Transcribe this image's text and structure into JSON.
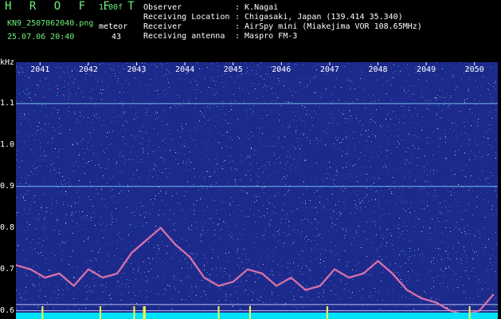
{
  "header": {
    "app_title": "H R O F F T",
    "version": "1.00f",
    "file_name": "KN9_2507062040.png",
    "timestamp": "25.07.06 20:40",
    "meteor_label": "meteor",
    "meteor_count": "43"
  },
  "station": {
    "observer_key": "Observer",
    "observer_val": ": K.Nagai",
    "location_key": "Receiving Location",
    "location_val": ": Chigasaki, Japan (139.414 35.340)",
    "receiver_key": "Receiver",
    "receiver_val": ": AirSpy mini (Miakejima VOR 108.65MHz)",
    "antenna_key": "Receiving antenna",
    "antenna_val": ": Maspro FM-3"
  },
  "axis": {
    "unit": "kHz",
    "ytick_labels": [
      "1.1",
      "1.0",
      "0.9",
      "0.8",
      "0.7",
      "0.6"
    ],
    "xtick_labels": [
      "2041",
      "2042",
      "2043",
      "2044",
      "2045",
      "2046",
      "2047",
      "2048",
      "2049",
      "2050"
    ]
  },
  "colors": {
    "background": "#000000",
    "spectrum_bg": "#1c2a8c",
    "header_green": "#6ff07a",
    "header_white": "#ffffff",
    "trace": "#e06aa0",
    "grid_line": "#7fd8ff",
    "bottom_band": "#00e0ff",
    "meteor_tick": "#ffff40"
  },
  "chart_data": {
    "type": "heatmap",
    "x_unit": "time (HHMM)",
    "y_unit": "kHz",
    "xlim": [
      "2040.5",
      "2050.5"
    ],
    "ylim": [
      0.58,
      1.2
    ],
    "ticks_x": [
      "2041",
      "2042",
      "2043",
      "2044",
      "2045",
      "2046",
      "2047",
      "2048",
      "2049",
      "2050"
    ],
    "ticks_y": [
      1.1,
      1.0,
      0.9,
      0.8,
      0.7,
      0.6
    ],
    "reference_lines_y": [
      1.1,
      0.9,
      0.615,
      0.6
    ],
    "trace": {
      "x": [
        2040.5,
        2040.8,
        2041.1,
        2041.4,
        2041.7,
        2042.0,
        2042.3,
        2042.6,
        2042.9,
        2043.2,
        2043.5,
        2043.8,
        2044.1,
        2044.4,
        2044.7,
        2045.0,
        2045.3,
        2045.6,
        2045.9,
        2046.2,
        2046.5,
        2046.8,
        2047.1,
        2047.4,
        2047.7,
        2048.0,
        2048.3,
        2048.6,
        2048.9,
        2049.2,
        2049.5,
        2049.8,
        2050.1,
        2050.4
      ],
      "y": [
        0.71,
        0.7,
        0.68,
        0.69,
        0.66,
        0.7,
        0.68,
        0.69,
        0.74,
        0.77,
        0.8,
        0.76,
        0.73,
        0.68,
        0.66,
        0.67,
        0.7,
        0.69,
        0.66,
        0.68,
        0.65,
        0.66,
        0.7,
        0.68,
        0.69,
        0.72,
        0.69,
        0.65,
        0.63,
        0.62,
        0.6,
        0.59,
        0.6,
        0.64
      ]
    },
    "meteor_ticks_x": [
      2041.05,
      2042.25,
      2042.95,
      2043.15,
      2043.17,
      2044.7,
      2045.35,
      2046.95,
      2049.9
    ]
  }
}
